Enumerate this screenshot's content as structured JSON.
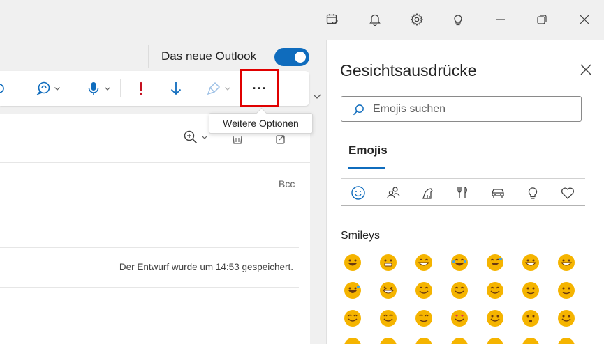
{
  "titlebar": {
    "icons": [
      "calendar-check-icon",
      "bell-icon",
      "gear-icon",
      "lightbulb-icon",
      "minimize-icon",
      "restore-icon",
      "close-icon"
    ]
  },
  "toggle": {
    "label": "Das neue Outlook",
    "state": "on"
  },
  "ribbon": {
    "more_options_symbol": "···"
  },
  "tooltip": {
    "text": "Weitere Optionen"
  },
  "compose": {
    "bcc": "Bcc",
    "draft_status": "Der Entwurf wurde um 14:53 gespeichert."
  },
  "panel": {
    "title": "Gesichtsausdrücke",
    "search_placeholder": "Emojis suchen",
    "tab": "Emojis",
    "categories": [
      "smiley-icon",
      "people-icon",
      "animal-icon",
      "food-icon",
      "car-icon",
      "lightbulb-icon",
      "heart-icon"
    ],
    "section_title": "Smileys"
  },
  "colors": {
    "accent": "#0f6cbd",
    "highlight": "#e00000",
    "emoji_yellow": "#f5b400"
  }
}
